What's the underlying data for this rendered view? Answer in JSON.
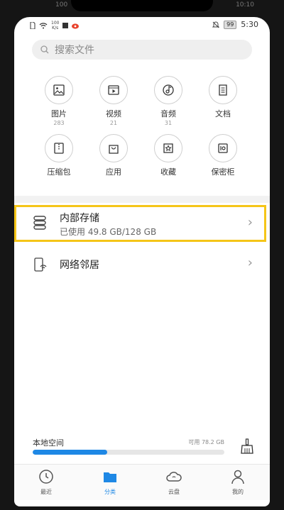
{
  "outer_status": {
    "left": "100",
    "right": "10:10"
  },
  "statusbar": {
    "speed_value": "100",
    "speed_unit": "K/s",
    "battery": "99",
    "time": "5:30"
  },
  "search": {
    "placeholder": "搜索文件"
  },
  "categories": [
    {
      "label": "图片",
      "count": "283",
      "icon": "image-icon"
    },
    {
      "label": "视频",
      "count": "21",
      "icon": "video-icon"
    },
    {
      "label": "音频",
      "count": "31",
      "icon": "audio-icon"
    },
    {
      "label": "文档",
      "count": "",
      "icon": "document-icon"
    },
    {
      "label": "压缩包",
      "count": "",
      "icon": "archive-icon"
    },
    {
      "label": "应用",
      "count": "",
      "icon": "app-icon"
    },
    {
      "label": "收藏",
      "count": "",
      "icon": "favorite-icon"
    },
    {
      "label": "保密柜",
      "count": "",
      "icon": "safe-icon"
    }
  ],
  "storage": {
    "title": "内部存储",
    "usage": "已使用 49.8 GB/128 GB"
  },
  "network": {
    "title": "网络邻居"
  },
  "local_space": {
    "label": "本地空间",
    "free": "可用 78.2 GB",
    "used_fraction": 0.39
  },
  "bottom_nav": [
    {
      "label": "最近",
      "icon": "clock-icon",
      "active": false
    },
    {
      "label": "分类",
      "icon": "folder-icon",
      "active": true
    },
    {
      "label": "云盘",
      "icon": "cloud-icon",
      "active": false
    },
    {
      "label": "我的",
      "icon": "user-icon",
      "active": false
    }
  ],
  "colors": {
    "accent": "#1e88e5",
    "highlight": "#f5c518"
  }
}
